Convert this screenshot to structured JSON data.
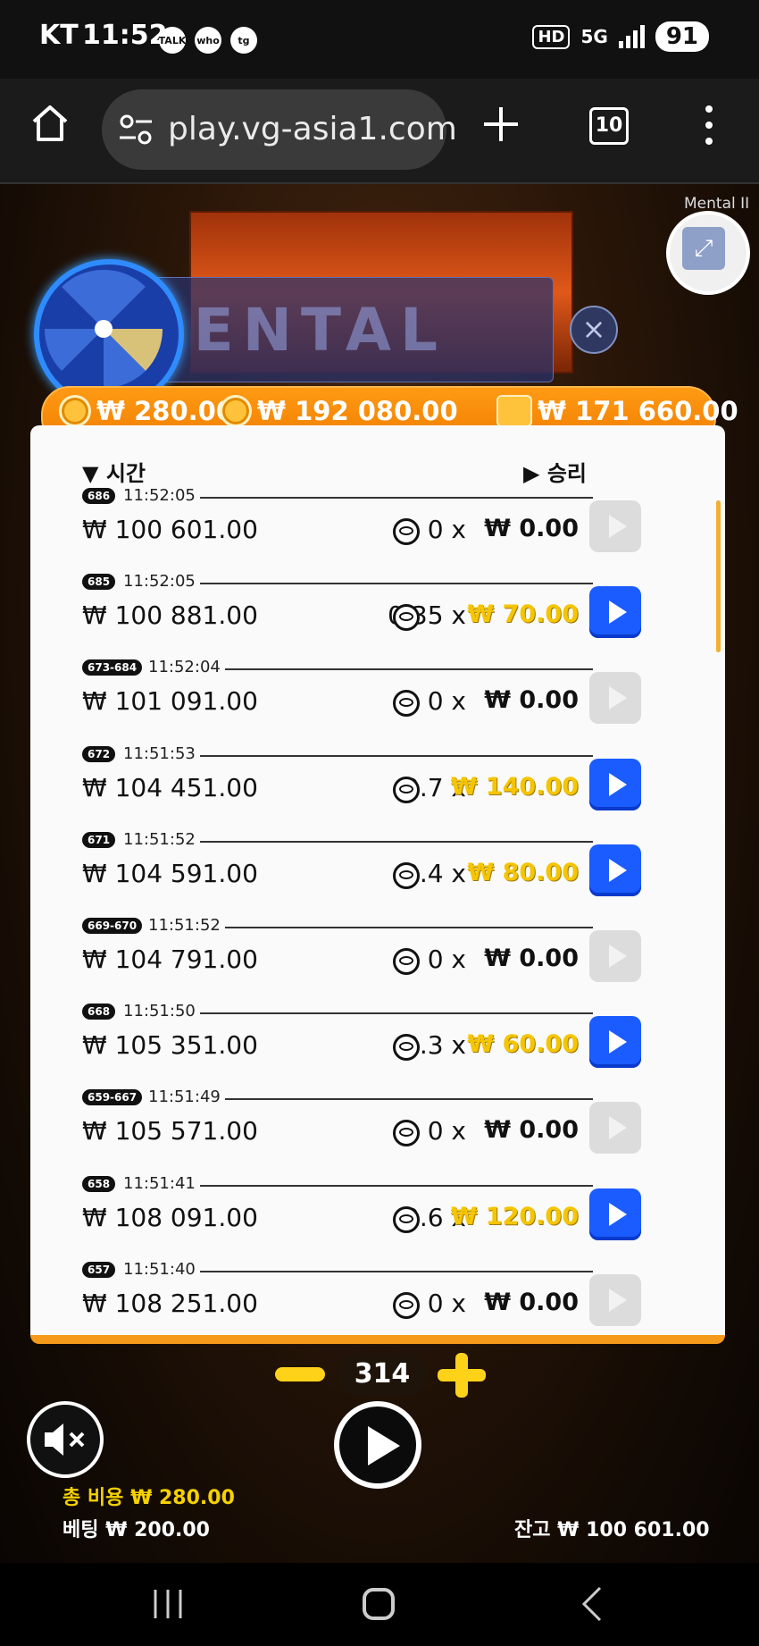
{
  "status": {
    "carrier": "KT",
    "time": "11:52",
    "apps": [
      "TALK",
      "who",
      "tg"
    ],
    "hd": "HD",
    "network": "5G",
    "battery": "91"
  },
  "browser": {
    "url": "play.vg-asia1.com",
    "tab_count": "10"
  },
  "game": {
    "banner_title": "MENTAL",
    "corner_label": "Mental II",
    "stats": {
      "total_bet": "₩ 280.00",
      "total_win": "₩ 192 080.00",
      "wallet": "₩ 171 660.00"
    },
    "history_headers": {
      "time": "시간",
      "win": "승리"
    },
    "history": [
      {
        "badge": "686",
        "time": "11:52:05",
        "balance": "₩ 100 601.00",
        "multiplier": "0 x",
        "win": "₩ 0.00",
        "gold": false
      },
      {
        "badge": "685",
        "time": "11:52:05",
        "balance": "₩ 100 881.00",
        "multiplier": "0.35 x",
        "win": "₩ 70.00",
        "gold": true
      },
      {
        "badge": "673-684",
        "time": "11:52:04",
        "balance": "₩ 101 091.00",
        "multiplier": "0 x",
        "win": "₩ 0.00",
        "gold": false
      },
      {
        "badge": "672",
        "time": "11:51:53",
        "balance": "₩ 104 451.00",
        "multiplier": "0.7 x",
        "win": "₩ 140.00",
        "gold": true
      },
      {
        "badge": "671",
        "time": "11:51:52",
        "balance": "₩ 104 591.00",
        "multiplier": "0.4 x",
        "win": "₩ 80.00",
        "gold": true
      },
      {
        "badge": "669-670",
        "time": "11:51:52",
        "balance": "₩ 104 791.00",
        "multiplier": "0 x",
        "win": "₩ 0.00",
        "gold": false
      },
      {
        "badge": "668",
        "time": "11:51:50",
        "balance": "₩ 105 351.00",
        "multiplier": "0.3 x",
        "win": "₩ 60.00",
        "gold": true
      },
      {
        "badge": "659-667",
        "time": "11:51:49",
        "balance": "₩ 105 571.00",
        "multiplier": "0 x",
        "win": "₩ 0.00",
        "gold": false
      },
      {
        "badge": "658",
        "time": "11:51:41",
        "balance": "₩ 108 091.00",
        "multiplier": "0.6 x",
        "win": "₩ 120.00",
        "gold": true
      },
      {
        "badge": "657",
        "time": "11:51:40",
        "balance": "₩ 108 251.00",
        "multiplier": "0 x",
        "win": "₩ 0.00",
        "gold": false
      }
    ],
    "bet_level": "314",
    "footer": {
      "cost_label": "총 비용",
      "cost_value": "₩ 280.00",
      "bet_label": "베팅",
      "bet_value": "₩ 200.00",
      "balance_label": "잔고",
      "balance_value": "₩ 100 601.00"
    }
  },
  "colors": {
    "accent_orange": "#f07d00",
    "win_gold": "#f5c500",
    "play_blue": "#1a5cff"
  }
}
